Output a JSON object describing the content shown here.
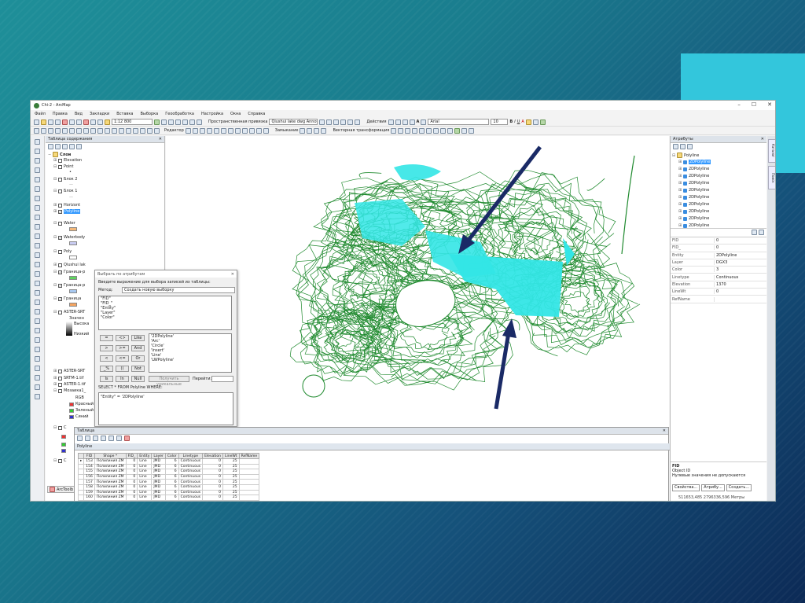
{
  "window": {
    "title": "Chi-2 - ArcMap",
    "controls": [
      "–",
      "☐",
      "✕"
    ]
  },
  "menu": [
    "Файл",
    "Правка",
    "Вид",
    "Закладки",
    "Вставка",
    "Выборка",
    "Геообработка",
    "Настройка",
    "Окна",
    "Справка"
  ],
  "toolbar": {
    "scale": "1:12 800",
    "georef_label": "Пространственная привязка",
    "georef_layer": "Qiushui lake dwg Annotation",
    "actions_label": "Действия",
    "font": "Arial",
    "font_size": "10",
    "editor_label": "Редактор",
    "snapping_label": "Замыкание",
    "vector_transform_label": "Векторная трансформация"
  },
  "toc": {
    "title": "Таблица содержания",
    "root": "Слои",
    "layers": [
      {
        "label": "Elevation",
        "checked": false
      },
      {
        "label": "Point",
        "checked": false
      },
      {
        "label": "Блок 2",
        "checked": false
      },
      {
        "label": "Блок 1",
        "checked": false
      },
      {
        "label": "Horizont",
        "checked": false
      },
      {
        "label": "Polyline",
        "checked": true
      },
      {
        "label": "Water",
        "checked": false
      },
      {
        "label": "Waterbody",
        "checked": true
      },
      {
        "label": "Poly",
        "checked": false
      },
      {
        "label": "Qiushui lak",
        "checked": false
      },
      {
        "label": "Граница-р",
        "checked": true
      },
      {
        "label": "Граница-р",
        "checked": true
      },
      {
        "label": "Граница",
        "checked": true
      },
      {
        "label": "ASTER-SRT",
        "checked": false
      },
      {
        "label": "Значен",
        "checked": false
      },
      {
        "label": "Высока",
        "checked": false
      },
      {
        "label": "Низкий",
        "checked": false
      },
      {
        "label": "ASTER-SRT",
        "checked": false
      },
      {
        "label": "SRTM-1.tif",
        "checked": false
      },
      {
        "label": "ASTER-1.tif",
        "checked": false
      },
      {
        "label": "Мозаика1_",
        "checked": false
      },
      {
        "label": "RGB",
        "checked": false
      },
      {
        "label": "Красный",
        "checked": false
      },
      {
        "label": "Зеленый",
        "checked": false
      },
      {
        "label": "Синий",
        "checked": false
      }
    ],
    "toolbox_tab": "ArcToolb"
  },
  "select_dialog": {
    "title": "Выбрать по атрибутам",
    "prompt": "Введите выражение для выбора записей из таблицы:",
    "method_label": "Метод:",
    "method_value": "Создать новую выборку",
    "fields": [
      "\"FID\"",
      "\"FID_\"",
      "\"Entity\"",
      "\"Layer\"",
      "\"Color\""
    ],
    "operators": [
      "=",
      "<>",
      "Like",
      ">",
      ">=",
      "And",
      "<",
      "<=",
      "Or",
      "_%",
      "()",
      "Not",
      "Is",
      "In",
      "Null"
    ],
    "values": [
      "'2DPolyline'",
      "'Arc'",
      "'Circle'",
      "'Insert'",
      "'Line'",
      "'LWPolyline'"
    ],
    "unique_button": "Получить уникальные",
    "goto_label": "Перейти:",
    "where_label": "SELECT * FROM Polyline WHERE:",
    "expression": "\"Entity\" = '2DPolyline'"
  },
  "attributes": {
    "title": "Атрибуты",
    "layer": "Polyline",
    "items": [
      "2DPolyline",
      "2DPolyline",
      "2DPolyline",
      "2DPolyline",
      "2DPolyline",
      "2DPolyline",
      "2DPolyline",
      "2DPolyline",
      "2DPolyline",
      "2DPolyline"
    ],
    "fields": [
      {
        "name": "FID",
        "value": "0"
      },
      {
        "name": "FID_",
        "value": "0"
      },
      {
        "name": "Entity",
        "value": "2DPolyline"
      },
      {
        "name": "Layer",
        "value": "DGX3"
      },
      {
        "name": "Color",
        "value": "3"
      },
      {
        "name": "Linetype",
        "value": "Continuous"
      },
      {
        "name": "Elevation",
        "value": "1370"
      },
      {
        "name": "LineWt",
        "value": "0"
      },
      {
        "name": "RefName",
        "value": ""
      }
    ],
    "desc_title": "FID",
    "desc_line1": "Object ID",
    "desc_line2": "Нулевые значения не допускаются",
    "tabs": [
      "Свойства...",
      "Атрибу...",
      "Создать..."
    ],
    "status": "511653,485  2796336,596 Метры"
  },
  "attr_table": {
    "window_title": "Таблица",
    "tab": "Polyline",
    "columns": [
      "FID",
      "Shape *",
      "FID_",
      "Entity",
      "Layer",
      "Color",
      "Linetype",
      "Elevation",
      "LineWt",
      "RefName"
    ],
    "rows": [
      [
        "153",
        "Полилиния ZM",
        "0",
        "Line",
        "JMD",
        "6",
        "Continuous",
        "0",
        "25",
        ""
      ],
      [
        "154",
        "Полилиния ZM",
        "0",
        "Line",
        "JMD",
        "6",
        "Continuous",
        "0",
        "25",
        ""
      ],
      [
        "155",
        "Полилиния ZM",
        "0",
        "Line",
        "JMD",
        "6",
        "Continuous",
        "0",
        "25",
        ""
      ],
      [
        "156",
        "Полилиния ZM",
        "0",
        "Line",
        "JMD",
        "6",
        "Continuous",
        "0",
        "25",
        ""
      ],
      [
        "157",
        "Полилиния ZM",
        "0",
        "Line",
        "JMD",
        "6",
        "Continuous",
        "0",
        "25",
        ""
      ],
      [
        "158",
        "Полилиния ZM",
        "0",
        "Line",
        "JMD",
        "6",
        "Continuous",
        "0",
        "25",
        ""
      ],
      [
        "159",
        "Полилиния ZM",
        "0",
        "Line",
        "JMD",
        "6",
        "Continuous",
        "0",
        "25",
        ""
      ],
      [
        "160",
        "Полилиния ZM",
        "0",
        "Line",
        "JMD",
        "6",
        "Continuous",
        "0",
        "25",
        ""
      ]
    ]
  },
  "colors": {
    "contour": "#1f8a2e",
    "water": "#33e6e6",
    "arrow": "#1a2a66",
    "accent": "#33c6dc"
  }
}
